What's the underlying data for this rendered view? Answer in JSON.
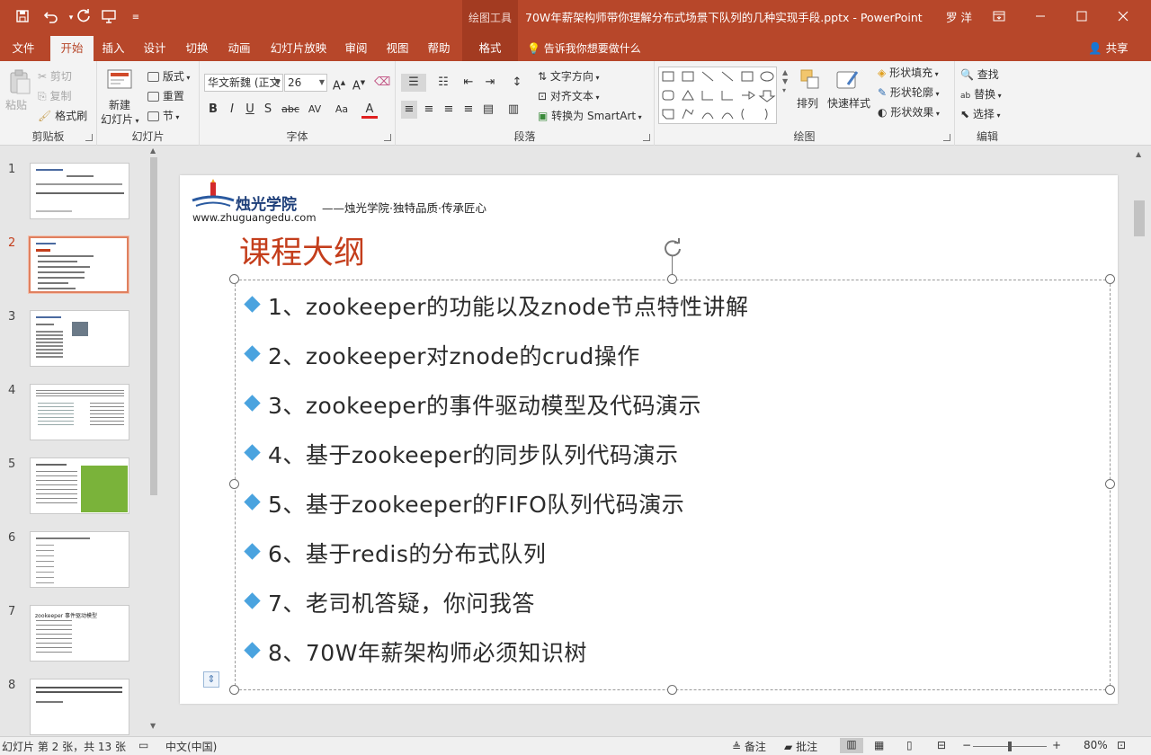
{
  "titlebar": {
    "context_tab_group": "绘图工具",
    "document_title": "70W年薪架构师带你理解分布式场景下队列的几种实现手段.pptx - PowerPoint",
    "user": "罗 洋",
    "qa_save_icon": "save-icon",
    "qa_undo_icon": "undo-icon",
    "qa_redo_icon": "redo-icon",
    "qa_present_icon": "present-from-start-icon"
  },
  "tabs": {
    "items": [
      "文件",
      "开始",
      "插入",
      "设计",
      "切换",
      "动画",
      "幻灯片放映",
      "审阅",
      "视图",
      "帮助",
      "格式"
    ],
    "active": "开始",
    "tell_me": "告诉我你想要做什么",
    "share": "共享"
  },
  "ribbon": {
    "clipboard": {
      "label": "剪贴板",
      "paste": "粘贴",
      "cut": "剪切",
      "copy": "复制",
      "format_painter": "格式刷"
    },
    "slides": {
      "label": "幻灯片",
      "new_slide": "新建",
      "new_slide2": "幻灯片",
      "layout": "版式",
      "reset": "重置",
      "section": "节"
    },
    "font": {
      "label": "字体",
      "font_name": "华文新魏 (正文",
      "font_size": "26",
      "bold": "B",
      "italic": "I",
      "underline": "U",
      "shadow": "S",
      "strike": "abc",
      "spacing": "AV",
      "case": "Aa",
      "color": "A"
    },
    "paragraph": {
      "label": "段落",
      "text_direction": "文字方向",
      "align_text": "对齐文本",
      "smartart": "转换为 SmartArt"
    },
    "drawing": {
      "label": "绘图",
      "arrange": "排列",
      "quick_styles": "快速样式",
      "shape_fill": "形状填充",
      "shape_outline": "形状轮廓",
      "shape_effects": "形状效果"
    },
    "editing": {
      "label": "编辑",
      "find": "查找",
      "replace": "替换",
      "select": "选择"
    }
  },
  "thumbnails": {
    "numbers": [
      "1",
      "2",
      "3",
      "4",
      "5",
      "6",
      "7",
      "8"
    ],
    "active_index": 2,
    "slide7_title": "zookeeper 事件驱动模型"
  },
  "slide": {
    "logo_name": "烛光学院",
    "logo_slogan": "——烛光学院·独特品质·传承匠心",
    "logo_url": "www.zhuguangedu.com",
    "heading": "课程大纲",
    "bullets": [
      "1、zookeeper的功能以及znode节点特性讲解",
      "2、zookeeper对znode的crud操作",
      "3、zookeeper的事件驱动模型及代码演示",
      "4、基于zookeeper的同步队列代码演示",
      "5、基于zookeeper的FIFO队列代码演示",
      "6、基于redis的分布式队列",
      "7、老司机答疑，你问我答",
      "8、70W年薪架构师必须知识树"
    ]
  },
  "statusbar": {
    "slide_info": "幻灯片 第 2 张，共 13 张",
    "language": "中文(中国)",
    "notes": "备注",
    "comments": "批注",
    "zoom": "80%"
  },
  "colors": {
    "brand": "#b7472a",
    "heading": "#c43e1c",
    "bullet": "#4aa3df"
  }
}
